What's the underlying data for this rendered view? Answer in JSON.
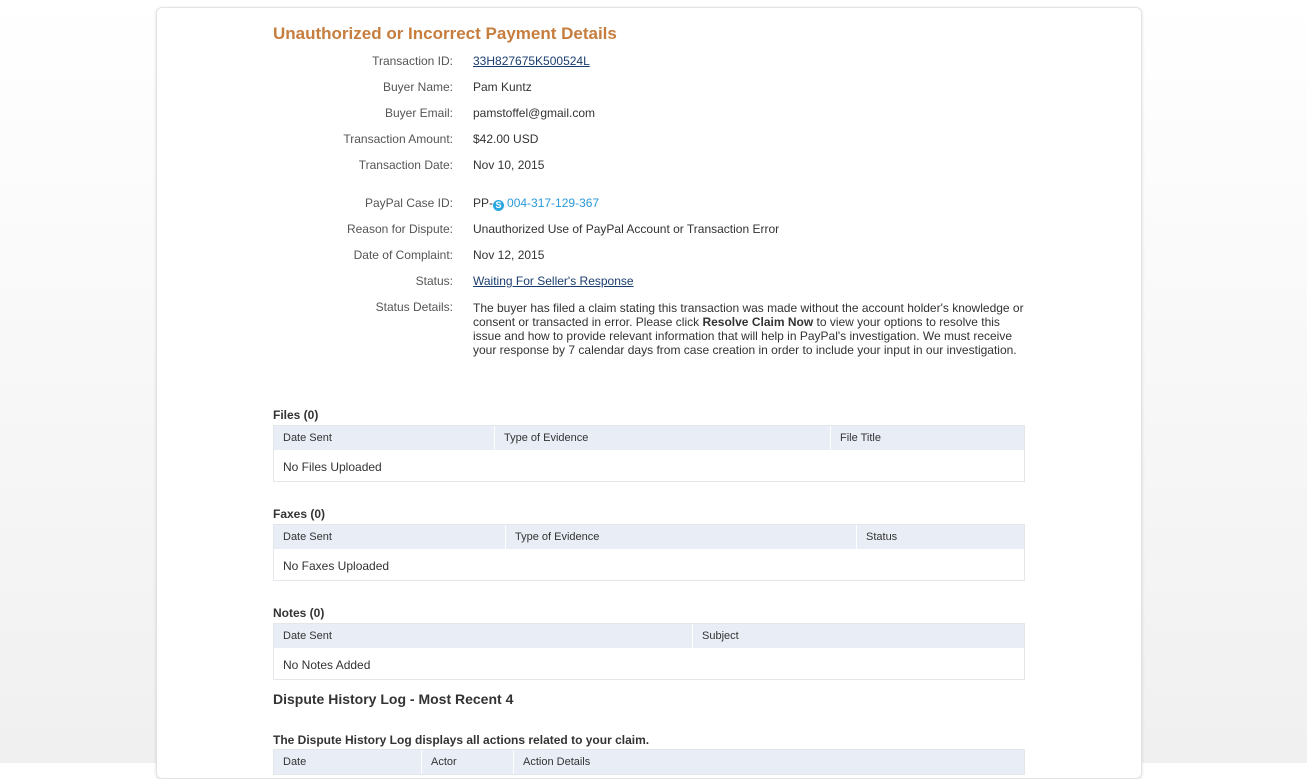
{
  "page_title": "Unauthorized or Incorrect Payment Details",
  "transaction": {
    "id_label": "Transaction ID:",
    "id_value": "33H827675K500524L",
    "buyer_name_label": "Buyer Name:",
    "buyer_name_value": "Pam Kuntz",
    "buyer_email_label": "Buyer Email:",
    "buyer_email_value": "pamstoffel@gmail.com",
    "amount_label": "Transaction Amount:",
    "amount_value": "$42.00 USD",
    "date_label": "Transaction Date:",
    "date_value": "Nov 10, 2015"
  },
  "case": {
    "case_id_label": "PayPal Case ID:",
    "case_id_prefix": "PP-",
    "case_id_icon": "skype-icon",
    "case_id_number": "004-317-129-367",
    "reason_label": "Reason for Dispute:",
    "reason_value": "Unauthorized Use of PayPal Account or Transaction Error",
    "complaint_date_label": "Date of Complaint:",
    "complaint_date_value": "Nov 12, 2015",
    "status_label": "Status:",
    "status_value": "Waiting For Seller's Response",
    "status_details_label": "Status Details:",
    "status_details_pre": "The buyer has filed a claim stating this transaction was made without the account holder's knowledge or consent or transacted in error. Please click ",
    "status_details_bold": "Resolve Claim Now",
    "status_details_post": " to view your options to resolve this issue and how to provide relevant information that will help in PayPal's investigation. We must receive your response by 7 calendar days from case creation in order to include your input in our investigation."
  },
  "files": {
    "title": "Files (0)",
    "columns": [
      "Date Sent",
      "Type of Evidence",
      "File Title"
    ],
    "empty_text": "No Files Uploaded"
  },
  "faxes": {
    "title": "Faxes (0)",
    "columns": [
      "Date Sent",
      "Type of Evidence",
      "Status"
    ],
    "empty_text": "No Faxes Uploaded"
  },
  "notes": {
    "title": "Notes (0)",
    "columns": [
      "Date Sent",
      "Subject"
    ],
    "empty_text": "No Notes Added"
  },
  "history": {
    "title": "Dispute History Log - Most Recent 4",
    "subtitle": "The Dispute History Log displays all actions related to your claim.",
    "columns": [
      "Date",
      "Actor",
      "Action Details"
    ]
  },
  "colors": {
    "title_orange": "#c67d3e",
    "link_dark": "#1a3d6e",
    "link_blue": "#2a9ad8",
    "table_header_bg": "#e9eef6"
  }
}
